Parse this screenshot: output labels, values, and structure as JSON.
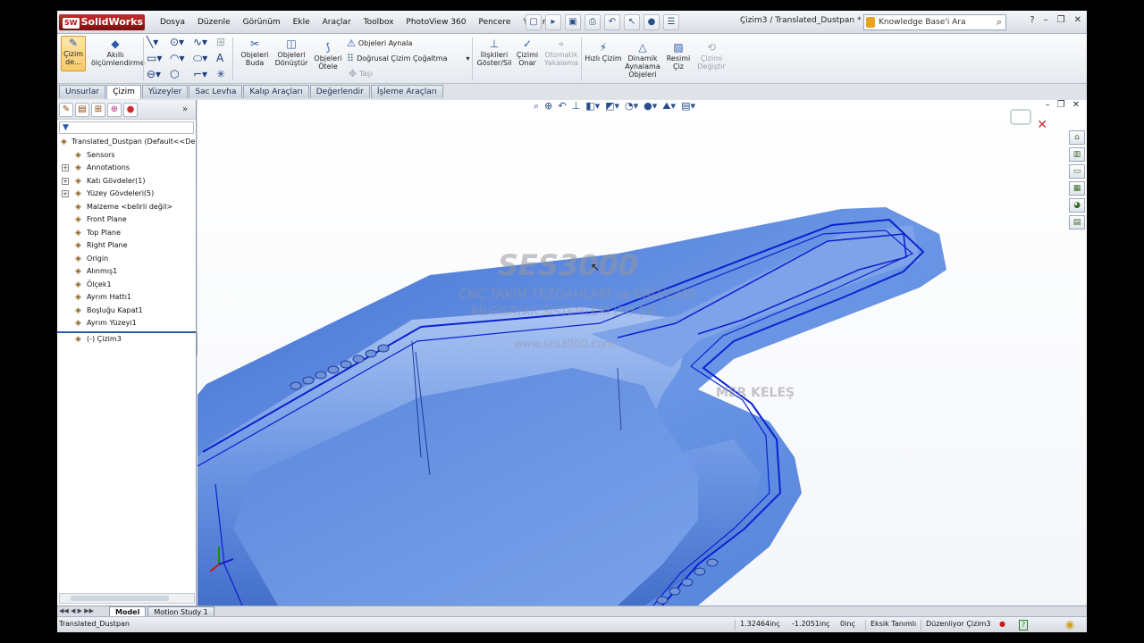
{
  "app": {
    "name": "SolidWorks",
    "logo_mark": "SW"
  },
  "menu": [
    "Dosya",
    "Düzenle",
    "Görünüm",
    "Ekle",
    "Araçlar",
    "Toolbox",
    "PhotoView 360",
    "Pencere",
    "Yardım"
  ],
  "quick_access_icons": [
    "pin-icon",
    "new-doc-icon",
    "open-icon",
    "save-icon",
    "print-icon",
    "undo-icon",
    "select-icon",
    "rebuild-icon",
    "options-icon"
  ],
  "document_title": "Çizim3 / Translated_Dustpan *",
  "search": {
    "placeholder": "Knowledge Base'i Ara"
  },
  "ribbon": {
    "sketch": "Çizim\nde...",
    "smart_dim": "Akıllı\nölçümlendirme",
    "trim": "Objeleri\nBuda",
    "convert": "Objeleri\nDönüştür",
    "offset": "Objeleri\nÖtele",
    "mirror": "Objeleri Aynala",
    "linear_pattern": "Doğrusal Çizim Çoğaltma",
    "move": "Taşı",
    "relations": "İlişkileri\nGöster/Sil",
    "repair": "Çizimi\nOnar",
    "auto_snap": "Otomatik\nYakalama",
    "rapid": "Hızlı Çizim",
    "dynamic_mirror": "Dinamik\nAynalama\nObjeleri",
    "picture": "Resimi\nÇiz",
    "modify": "Çizimi\nDeğiştir"
  },
  "tabs": [
    "Unsurlar",
    "Çizim",
    "Yüzeyler",
    "Sac Levha",
    "Kalıp Araçları",
    "Değerlendir",
    "İşleme Araçları"
  ],
  "active_tab": "Çizim",
  "feature_tree": {
    "root": "Translated_Dustpan  (Default<<De",
    "items": [
      {
        "label": "Sensors",
        "icon": "sensor-icon",
        "expandable": false
      },
      {
        "label": "Annotations",
        "icon": "annotation-icon",
        "expandable": true
      },
      {
        "label": "Katı Gövdeler(1)",
        "icon": "solid-bodies-icon",
        "expandable": true
      },
      {
        "label": "Yüzey Gövdeleri(5)",
        "icon": "surface-bodies-icon",
        "expandable": true
      },
      {
        "label": "Malzeme <belirli değil>",
        "icon": "material-icon",
        "expandable": false
      },
      {
        "label": "Front Plane",
        "icon": "plane-icon",
        "expandable": false
      },
      {
        "label": "Top Plane",
        "icon": "plane-icon",
        "expandable": false
      },
      {
        "label": "Right Plane",
        "icon": "plane-icon",
        "expandable": false
      },
      {
        "label": "Origin",
        "icon": "origin-icon",
        "expandable": false
      },
      {
        "label": "Alınmış1",
        "icon": "imported-icon",
        "expandable": false
      },
      {
        "label": "Ölçek1",
        "icon": "scale-icon",
        "expandable": false
      },
      {
        "label": "Ayrım Hattı1",
        "icon": "parting-line-icon",
        "expandable": false
      },
      {
        "label": "Boşluğu Kapat1",
        "icon": "shut-off-icon",
        "expandable": false
      },
      {
        "label": "Ayrım Yüzeyi1",
        "icon": "parting-surface-icon",
        "expandable": false
      }
    ],
    "after_rollback": [
      {
        "label": "(-) Çizim3",
        "icon": "sketch-icon",
        "expandable": false
      }
    ]
  },
  "watermark": {
    "brand": "SES3000",
    "line1": "CNC TAKIM TEZGAHLARI ve CAD/CAM",
    "line2": "BİLGİSAYAR SİSTEMLERİ LTD.ŞTİ.",
    "line3": "www.ses3000.com",
    "author": "MER KELEŞ"
  },
  "bottom_tabs": [
    "Model",
    "Motion Study 1"
  ],
  "active_bottom_tab": "Model",
  "status": {
    "doc": "Translated_Dustpan",
    "x": "1.32464inç",
    "y": "-1.2051inç",
    "z": "0inç",
    "defined": "Eksik Tanımlı",
    "editing": "Düzenliyor Çizim3"
  },
  "colors": {
    "model_blue": "#5a86d8",
    "edge_blue": "#0a22d0",
    "accent": "#2b5aa8"
  }
}
